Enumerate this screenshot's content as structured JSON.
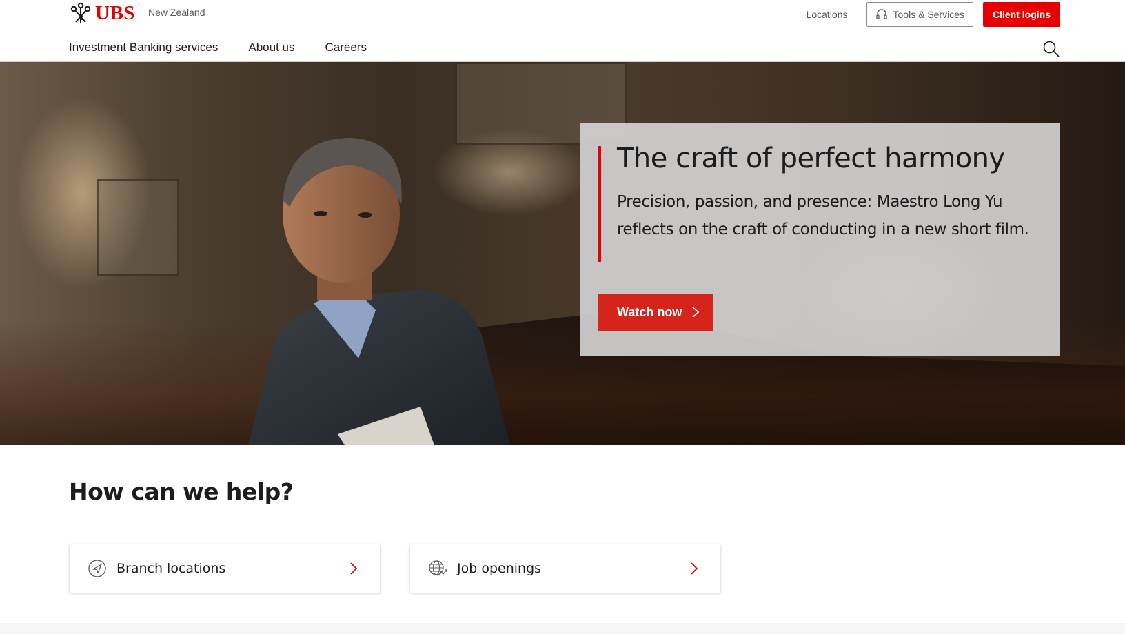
{
  "header": {
    "logo_text": "UBS",
    "region": "New Zealand",
    "locations_label": "Locations",
    "tools_label": "Tools & Services",
    "login_label": "Client logins",
    "nav": [
      "Investment Banking services",
      "About us",
      "Careers"
    ]
  },
  "hero": {
    "title": "The craft of perfect harmony",
    "description": "Precision, passion, and presence: Maestro Long Yu reflects on the craft of conducting in a new short film.",
    "cta_label": "Watch now"
  },
  "help": {
    "title": "How can we help?",
    "cards": [
      {
        "label": "Branch locations",
        "icon": "compass-icon"
      },
      {
        "label": "Job openings",
        "icon": "globe-icon"
      }
    ]
  },
  "colors": {
    "brand_red": "#e60000",
    "cta_red": "#d6241b",
    "text": "#1c1c1c",
    "muted": "#5a5a5a"
  }
}
